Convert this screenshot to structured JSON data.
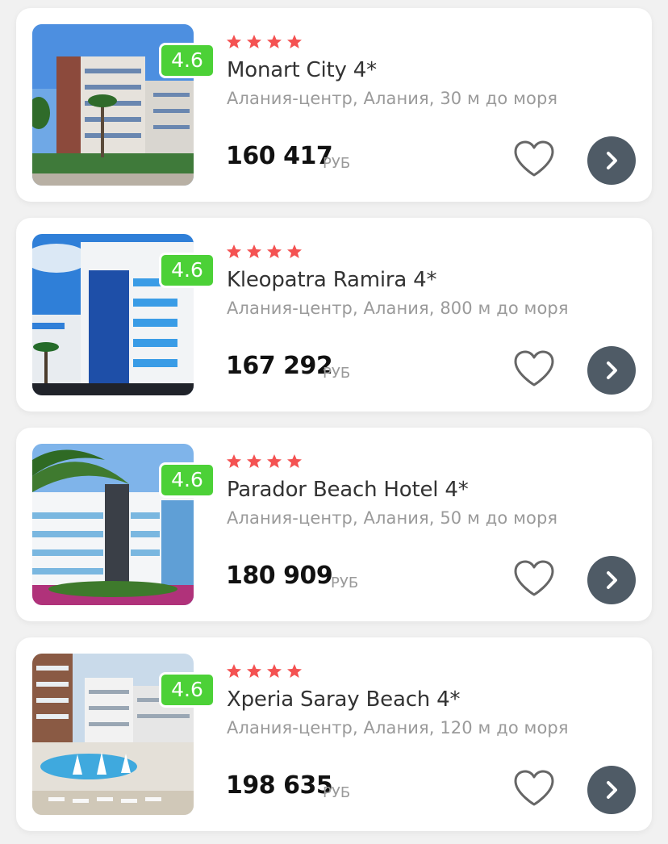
{
  "hotels": [
    {
      "rating": "4.6",
      "stars": 4,
      "name": "Monart City 4*",
      "location": "Алания-центр, Алания, 30 м до моря",
      "price": "160 417",
      "currency": "РУБ"
    },
    {
      "rating": "4.6",
      "stars": 4,
      "name": "Kleopatra Ramira 4*",
      "location": "Алания-центр, Алания, 800 м до моря",
      "price": "167 292",
      "currency": "РУБ"
    },
    {
      "rating": "4.6",
      "stars": 4,
      "name": "Parador Beach Hotel 4*",
      "location": "Алания-центр, Алания, 50 м до моря",
      "price": "180 909",
      "currency": "РУБ"
    },
    {
      "rating": "4.6",
      "stars": 4,
      "name": "Xperia Saray Beach 4*",
      "location": "Алания-центр, Алания, 120 м до моря",
      "price": "198 635",
      "currency": "РУБ"
    }
  ],
  "icons": {
    "star": "star-icon",
    "favorite": "heart-icon",
    "open": "chevron-right-icon"
  },
  "colors": {
    "rating_badge": "#4cd137",
    "star": "#f45252",
    "arrow_button": "#4f5b66",
    "heart_outline": "#666666"
  }
}
